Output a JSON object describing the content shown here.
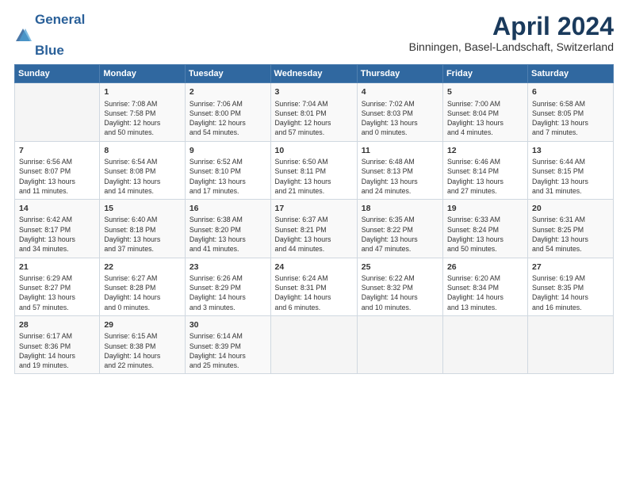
{
  "header": {
    "logo_line1": "General",
    "logo_line2": "Blue",
    "month_title": "April 2024",
    "location": "Binningen, Basel-Landschaft, Switzerland"
  },
  "days_of_week": [
    "Sunday",
    "Monday",
    "Tuesday",
    "Wednesday",
    "Thursday",
    "Friday",
    "Saturday"
  ],
  "weeks": [
    [
      {
        "day": "",
        "info": ""
      },
      {
        "day": "1",
        "info": "Sunrise: 7:08 AM\nSunset: 7:58 PM\nDaylight: 12 hours\nand 50 minutes."
      },
      {
        "day": "2",
        "info": "Sunrise: 7:06 AM\nSunset: 8:00 PM\nDaylight: 12 hours\nand 54 minutes."
      },
      {
        "day": "3",
        "info": "Sunrise: 7:04 AM\nSunset: 8:01 PM\nDaylight: 12 hours\nand 57 minutes."
      },
      {
        "day": "4",
        "info": "Sunrise: 7:02 AM\nSunset: 8:03 PM\nDaylight: 13 hours\nand 0 minutes."
      },
      {
        "day": "5",
        "info": "Sunrise: 7:00 AM\nSunset: 8:04 PM\nDaylight: 13 hours\nand 4 minutes."
      },
      {
        "day": "6",
        "info": "Sunrise: 6:58 AM\nSunset: 8:05 PM\nDaylight: 13 hours\nand 7 minutes."
      }
    ],
    [
      {
        "day": "7",
        "info": "Sunrise: 6:56 AM\nSunset: 8:07 PM\nDaylight: 13 hours\nand 11 minutes."
      },
      {
        "day": "8",
        "info": "Sunrise: 6:54 AM\nSunset: 8:08 PM\nDaylight: 13 hours\nand 14 minutes."
      },
      {
        "day": "9",
        "info": "Sunrise: 6:52 AM\nSunset: 8:10 PM\nDaylight: 13 hours\nand 17 minutes."
      },
      {
        "day": "10",
        "info": "Sunrise: 6:50 AM\nSunset: 8:11 PM\nDaylight: 13 hours\nand 21 minutes."
      },
      {
        "day": "11",
        "info": "Sunrise: 6:48 AM\nSunset: 8:13 PM\nDaylight: 13 hours\nand 24 minutes."
      },
      {
        "day": "12",
        "info": "Sunrise: 6:46 AM\nSunset: 8:14 PM\nDaylight: 13 hours\nand 27 minutes."
      },
      {
        "day": "13",
        "info": "Sunrise: 6:44 AM\nSunset: 8:15 PM\nDaylight: 13 hours\nand 31 minutes."
      }
    ],
    [
      {
        "day": "14",
        "info": "Sunrise: 6:42 AM\nSunset: 8:17 PM\nDaylight: 13 hours\nand 34 minutes."
      },
      {
        "day": "15",
        "info": "Sunrise: 6:40 AM\nSunset: 8:18 PM\nDaylight: 13 hours\nand 37 minutes."
      },
      {
        "day": "16",
        "info": "Sunrise: 6:38 AM\nSunset: 8:20 PM\nDaylight: 13 hours\nand 41 minutes."
      },
      {
        "day": "17",
        "info": "Sunrise: 6:37 AM\nSunset: 8:21 PM\nDaylight: 13 hours\nand 44 minutes."
      },
      {
        "day": "18",
        "info": "Sunrise: 6:35 AM\nSunset: 8:22 PM\nDaylight: 13 hours\nand 47 minutes."
      },
      {
        "day": "19",
        "info": "Sunrise: 6:33 AM\nSunset: 8:24 PM\nDaylight: 13 hours\nand 50 minutes."
      },
      {
        "day": "20",
        "info": "Sunrise: 6:31 AM\nSunset: 8:25 PM\nDaylight: 13 hours\nand 54 minutes."
      }
    ],
    [
      {
        "day": "21",
        "info": "Sunrise: 6:29 AM\nSunset: 8:27 PM\nDaylight: 13 hours\nand 57 minutes."
      },
      {
        "day": "22",
        "info": "Sunrise: 6:27 AM\nSunset: 8:28 PM\nDaylight: 14 hours\nand 0 minutes."
      },
      {
        "day": "23",
        "info": "Sunrise: 6:26 AM\nSunset: 8:29 PM\nDaylight: 14 hours\nand 3 minutes."
      },
      {
        "day": "24",
        "info": "Sunrise: 6:24 AM\nSunset: 8:31 PM\nDaylight: 14 hours\nand 6 minutes."
      },
      {
        "day": "25",
        "info": "Sunrise: 6:22 AM\nSunset: 8:32 PM\nDaylight: 14 hours\nand 10 minutes."
      },
      {
        "day": "26",
        "info": "Sunrise: 6:20 AM\nSunset: 8:34 PM\nDaylight: 14 hours\nand 13 minutes."
      },
      {
        "day": "27",
        "info": "Sunrise: 6:19 AM\nSunset: 8:35 PM\nDaylight: 14 hours\nand 16 minutes."
      }
    ],
    [
      {
        "day": "28",
        "info": "Sunrise: 6:17 AM\nSunset: 8:36 PM\nDaylight: 14 hours\nand 19 minutes."
      },
      {
        "day": "29",
        "info": "Sunrise: 6:15 AM\nSunset: 8:38 PM\nDaylight: 14 hours\nand 22 minutes."
      },
      {
        "day": "30",
        "info": "Sunrise: 6:14 AM\nSunset: 8:39 PM\nDaylight: 14 hours\nand 25 minutes."
      },
      {
        "day": "",
        "info": ""
      },
      {
        "day": "",
        "info": ""
      },
      {
        "day": "",
        "info": ""
      },
      {
        "day": "",
        "info": ""
      }
    ]
  ]
}
